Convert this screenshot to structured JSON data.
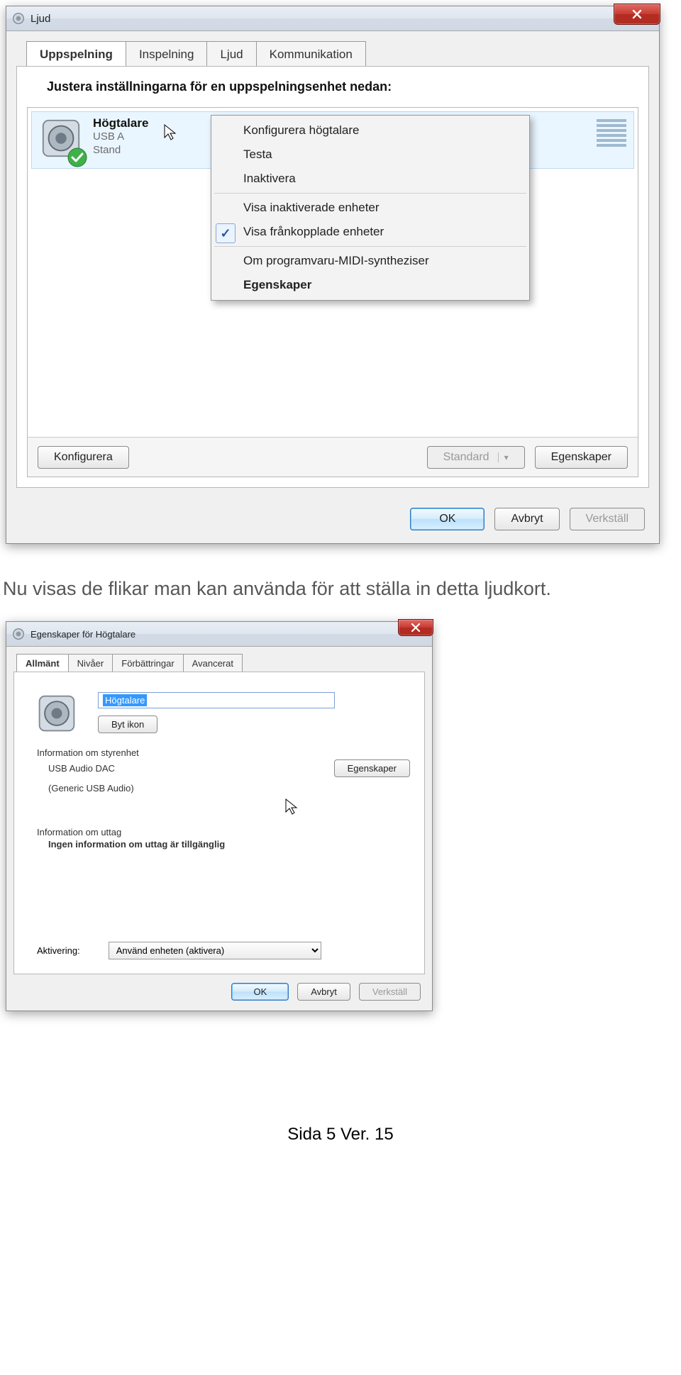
{
  "win1": {
    "title": "Ljud",
    "tabs": [
      "Uppspelning",
      "Inspelning",
      "Ljud",
      "Kommunikation"
    ],
    "active_tab": 0,
    "prompt": "Justera inställningarna för en uppspelningsenhet nedan:",
    "device": {
      "name": "Högtalare",
      "device_line": "USB A",
      "status_line": "Stand"
    },
    "context_menu": {
      "cfg": "Konfigurera högtalare",
      "test": "Testa",
      "disable": "Inaktivera",
      "show_disabled": "Visa inaktiverade enheter",
      "show_disconnected": "Visa frånkopplade enheter",
      "midi": "Om programvaru-MIDI-syntheziser",
      "props": "Egenskaper"
    },
    "inner_buttons": {
      "configure": "Konfigurera",
      "default": "Standard",
      "properties": "Egenskaper"
    },
    "footer": {
      "ok": "OK",
      "cancel": "Avbryt",
      "apply": "Verkställ"
    }
  },
  "caption": "Nu visas de flikar man kan använda för att ställa in detta ljudkort.",
  "win2": {
    "title": "Egenskaper för Högtalare",
    "tabs": [
      "Allmänt",
      "Nivåer",
      "Förbättringar",
      "Avancerat"
    ],
    "active_tab": 0,
    "name_value": "Högtalare",
    "change_icon": "Byt ikon",
    "controller_heading": "Information om styrenhet",
    "controller_name": "USB Audio DAC",
    "controller_sub": "(Generic USB Audio)",
    "controller_props": "Egenskaper",
    "jack_heading": "Information om uttag",
    "jack_text": "Ingen information om uttag är tillgänglig",
    "activation_label": "Aktivering:",
    "activation_value": "Använd enheten (aktivera)",
    "footer": {
      "ok": "OK",
      "cancel": "Avbryt",
      "apply": "Verkställ"
    }
  },
  "page_footer": "Sida 5   Ver. 15"
}
